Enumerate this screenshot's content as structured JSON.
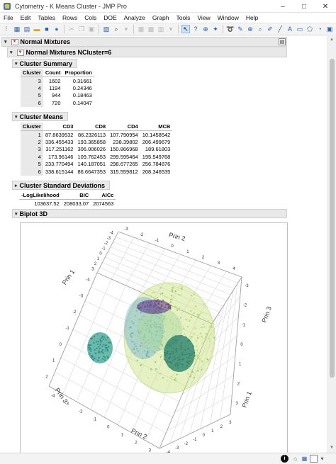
{
  "window": {
    "title": "Cytometry - K Means Cluster - JMP Pro"
  },
  "menu": [
    "File",
    "Edit",
    "Tables",
    "Rows",
    "Cols",
    "DOE",
    "Analyze",
    "Graph",
    "Tools",
    "View",
    "Window",
    "Help"
  ],
  "report": {
    "outer_title": "Normal Mixtures",
    "inner_title": "Normal Mixtures NCluster=6",
    "cluster_summary": {
      "title": "Cluster Summary",
      "headers": [
        "Cluster",
        "Count",
        "Proportion"
      ],
      "rows": [
        [
          "3",
          "1602",
          "0.31661"
        ],
        [
          "4",
          "1194",
          "0.24346"
        ],
        [
          "5",
          "944",
          "0.18463"
        ],
        [
          "6",
          "720",
          "0.14047"
        ]
      ]
    },
    "cluster_means": {
      "title": "Cluster Means",
      "headers": [
        "Cluster",
        "CD3",
        "CD8",
        "CD4",
        "MCB"
      ],
      "rows": [
        [
          "1",
          "87.8639532",
          "86.2326113",
          "107.790954",
          "10.1458542"
        ],
        [
          "2",
          "336.455433",
          "193.365858",
          "238.39802",
          "206.499679"
        ],
        [
          "3",
          "317.251162",
          "306.006026",
          "150.866968",
          "189.61803"
        ],
        [
          "4",
          "173.96146",
          "109.762453",
          "299.595464",
          "195.549768"
        ],
        [
          "5",
          "233.770494",
          "140.187051",
          "298.677265",
          "256.784876"
        ],
        [
          "6",
          "338.615144",
          "86.6647353",
          "315.559812",
          "208.346535"
        ]
      ]
    },
    "cluster_sd": {
      "title": "Cluster Standard Deviations"
    },
    "fit": {
      "headers": [
        "-LogLikelihood",
        "BIC",
        "AICc"
      ],
      "values": [
        "103637.52",
        "208033.07",
        "2074563"
      ]
    },
    "biplot": {
      "title": "Biplot 3D",
      "axis_labels": [
        "Prin 2",
        "Prin 1",
        "Prin 3",
        "Prin 1",
        "Prin 3",
        "Prin 2"
      ],
      "ticks_top": [
        "-3",
        "-2",
        "-1",
        "0",
        "1",
        "2",
        "3",
        "4"
      ],
      "ticks_left": [
        "-4",
        "-3",
        "-2",
        "-1",
        "0",
        "1",
        "2",
        "3"
      ],
      "ticks_right": [
        "-3",
        "-2",
        "-1",
        "0",
        "1",
        "2",
        "3"
      ],
      "ticks_bottom_left": [
        "-4",
        "-3",
        "-2",
        "-1",
        "0",
        "1",
        "2"
      ],
      "ticks_bottom": [
        "-4",
        "-3",
        "-2",
        "-1",
        "0",
        "1",
        "2",
        "3"
      ],
      "ticks_bottom_right": [
        "-4",
        "-3",
        "-2",
        "-1",
        "0",
        "1",
        "2",
        "3"
      ]
    }
  },
  "colors": {
    "accent": "#2a5ea8",
    "cluster_teal": "#1f8a7a",
    "cluster_green": "#9ccc65",
    "cluster_purple": "#5b2a86",
    "ellipsoid_green": "#c8e07a",
    "ellipsoid_blue": "#5fa8d3"
  }
}
